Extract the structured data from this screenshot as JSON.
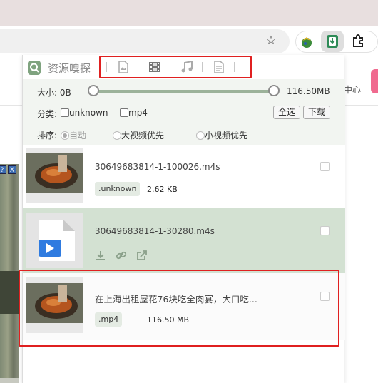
{
  "browser": {
    "icons": {
      "star": "star-icon",
      "ext_map": "globe-extension-icon",
      "ext_download": "download-extension-icon",
      "ext_puzzle": "puzzle-icon"
    }
  },
  "page_behind": {
    "right_text": "中心"
  },
  "panel": {
    "title": "资源嗅探",
    "tabs": [
      "image-tab-icon",
      "video-tab-icon",
      "audio-tab-icon",
      "document-tab-icon"
    ],
    "size_label": "大小: 0B",
    "size_max": "116.50MB",
    "category_label": "分类:",
    "categories": [
      "unknown",
      "mp4"
    ],
    "select_all": "全选",
    "download": "下载",
    "sort_label": "排序:",
    "sort_options": [
      "自动",
      "大视频优先",
      "小视频优先"
    ],
    "sort_selected": "自动"
  },
  "items": [
    {
      "name": "30649683814-1-100026.m4s",
      "tag": ".unknown",
      "size": "2.62 KB",
      "thumb": "food-video-thumbnail"
    },
    {
      "name": "30649683814-1-30280.m4s",
      "thumb": "video-file-icon",
      "actions": [
        "download-icon",
        "link-icon",
        "share-icon"
      ]
    },
    {
      "name": "在上海出租屋花76块吃全肉宴，大口吃...",
      "tag": ".mp4",
      "size": "116.50 MB",
      "thumb": "food-video-thumbnail"
    }
  ],
  "colors": {
    "accent_green": "#9cb29a",
    "selected_row": "#d3e1d2",
    "highlight_red": "#e02020"
  }
}
